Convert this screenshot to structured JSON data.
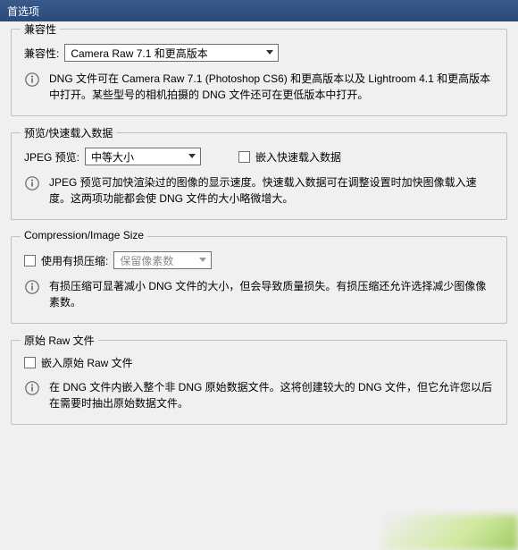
{
  "titlebar": {
    "title": "首选项"
  },
  "group1": {
    "title": "兼容性",
    "label": "兼容性:",
    "dropdown": "Camera Raw 7.1 和更高版本",
    "info": "DNG 文件可在 Camera Raw 7.1 (Photoshop CS6) 和更高版本以及 Lightroom 4.1 和更高版本中打开。某些型号的相机拍摄的 DNG 文件还可在更低版本中打开。"
  },
  "group2": {
    "title": "预览/快速载入数据",
    "label": "JPEG 预览:",
    "dropdown": "中等大小",
    "checkbox_label": "嵌入快速载入数据",
    "info": "JPEG 预览可加快渲染过的图像的显示速度。快速载入数据可在调整设置时加快图像载入速度。这两项功能都会使 DNG 文件的大小略微增大。"
  },
  "group3": {
    "title": "Compression/Image Size",
    "checkbox_label": "使用有损压缩:",
    "dropdown": "保留像素数",
    "info": "有损压缩可显著减小 DNG 文件的大小，但会导致质量损失。有损压缩还允许选择减少图像像素数。"
  },
  "group4": {
    "title": "原始 Raw 文件",
    "checkbox_label": "嵌入原始 Raw 文件",
    "info": "在 DNG 文件内嵌入整个非 DNG 原始数据文件。这将创建较大的 DNG 文件，但它允许您以后在需要时抽出原始数据文件。"
  }
}
